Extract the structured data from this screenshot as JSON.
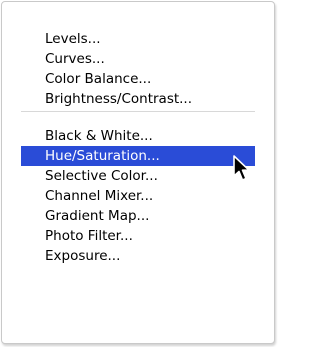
{
  "menu": {
    "group1": [
      {
        "label": "Levels..."
      },
      {
        "label": "Curves..."
      },
      {
        "label": "Color Balance..."
      },
      {
        "label": "Brightness/Contrast..."
      }
    ],
    "group2": [
      {
        "label": "Black & White..."
      },
      {
        "label": "Hue/Saturation...",
        "selected": true
      },
      {
        "label": "Selective Color..."
      },
      {
        "label": "Channel Mixer..."
      },
      {
        "label": "Gradient Map..."
      },
      {
        "label": "Photo Filter..."
      },
      {
        "label": "Exposure..."
      }
    ]
  },
  "colors": {
    "highlight": "#2a4cd7",
    "separator": "#d8d8d8"
  },
  "icons": {
    "cursor": "arrow-cursor-icon"
  }
}
